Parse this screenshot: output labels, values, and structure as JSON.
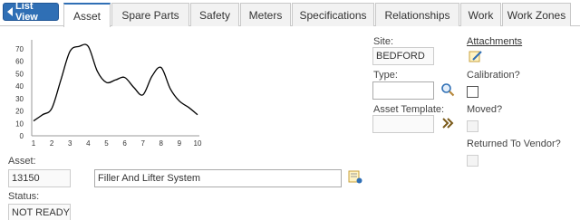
{
  "toolbar": {
    "list_view_label": "List View"
  },
  "tabs": [
    {
      "label": "Asset",
      "active": true
    },
    {
      "label": "Spare Parts"
    },
    {
      "label": "Safety"
    },
    {
      "label": "Meters"
    },
    {
      "label": "Specifications"
    },
    {
      "label": "Relationships"
    },
    {
      "label": "Work"
    },
    {
      "label": "Work Zones"
    }
  ],
  "chart_data": {
    "type": "line",
    "x": [
      1,
      1.5,
      2,
      2.5,
      3,
      3.5,
      4,
      4.5,
      5,
      5.5,
      6,
      6.5,
      7,
      7.5,
      8,
      8.5,
      9,
      9.5,
      10
    ],
    "y": [
      12,
      17,
      22,
      45,
      68,
      72,
      72,
      52,
      43,
      45,
      47,
      39,
      33,
      48,
      55,
      38,
      28,
      23,
      17
    ],
    "xticks": [
      "1",
      "2",
      "3",
      "4",
      "5",
      "6",
      "7",
      "8",
      "9",
      "10"
    ],
    "yticks": [
      "0",
      "10",
      "20",
      "30",
      "40",
      "50",
      "60",
      "70"
    ],
    "xlim": [
      1,
      10
    ],
    "ylim": [
      0,
      70
    ],
    "grid": false
  },
  "form": {
    "asset_label": "Asset:",
    "asset_value": "13150",
    "asset_description": "Filler And Lifter System",
    "status_label": "Status:",
    "status_value": "NOT READY",
    "site_label": "Site:",
    "site_value": "BEDFORD",
    "type_label": "Type:",
    "type_value": "",
    "asset_template_label": "Asset Template:",
    "asset_template_value": "",
    "attachments_label": "Attachments",
    "calibration_label": "Calibration?",
    "moved_label": "Moved?",
    "returned_label": "Returned To Vendor?"
  },
  "colors": {
    "accent": "#2f6fb5",
    "line": "#000000"
  }
}
